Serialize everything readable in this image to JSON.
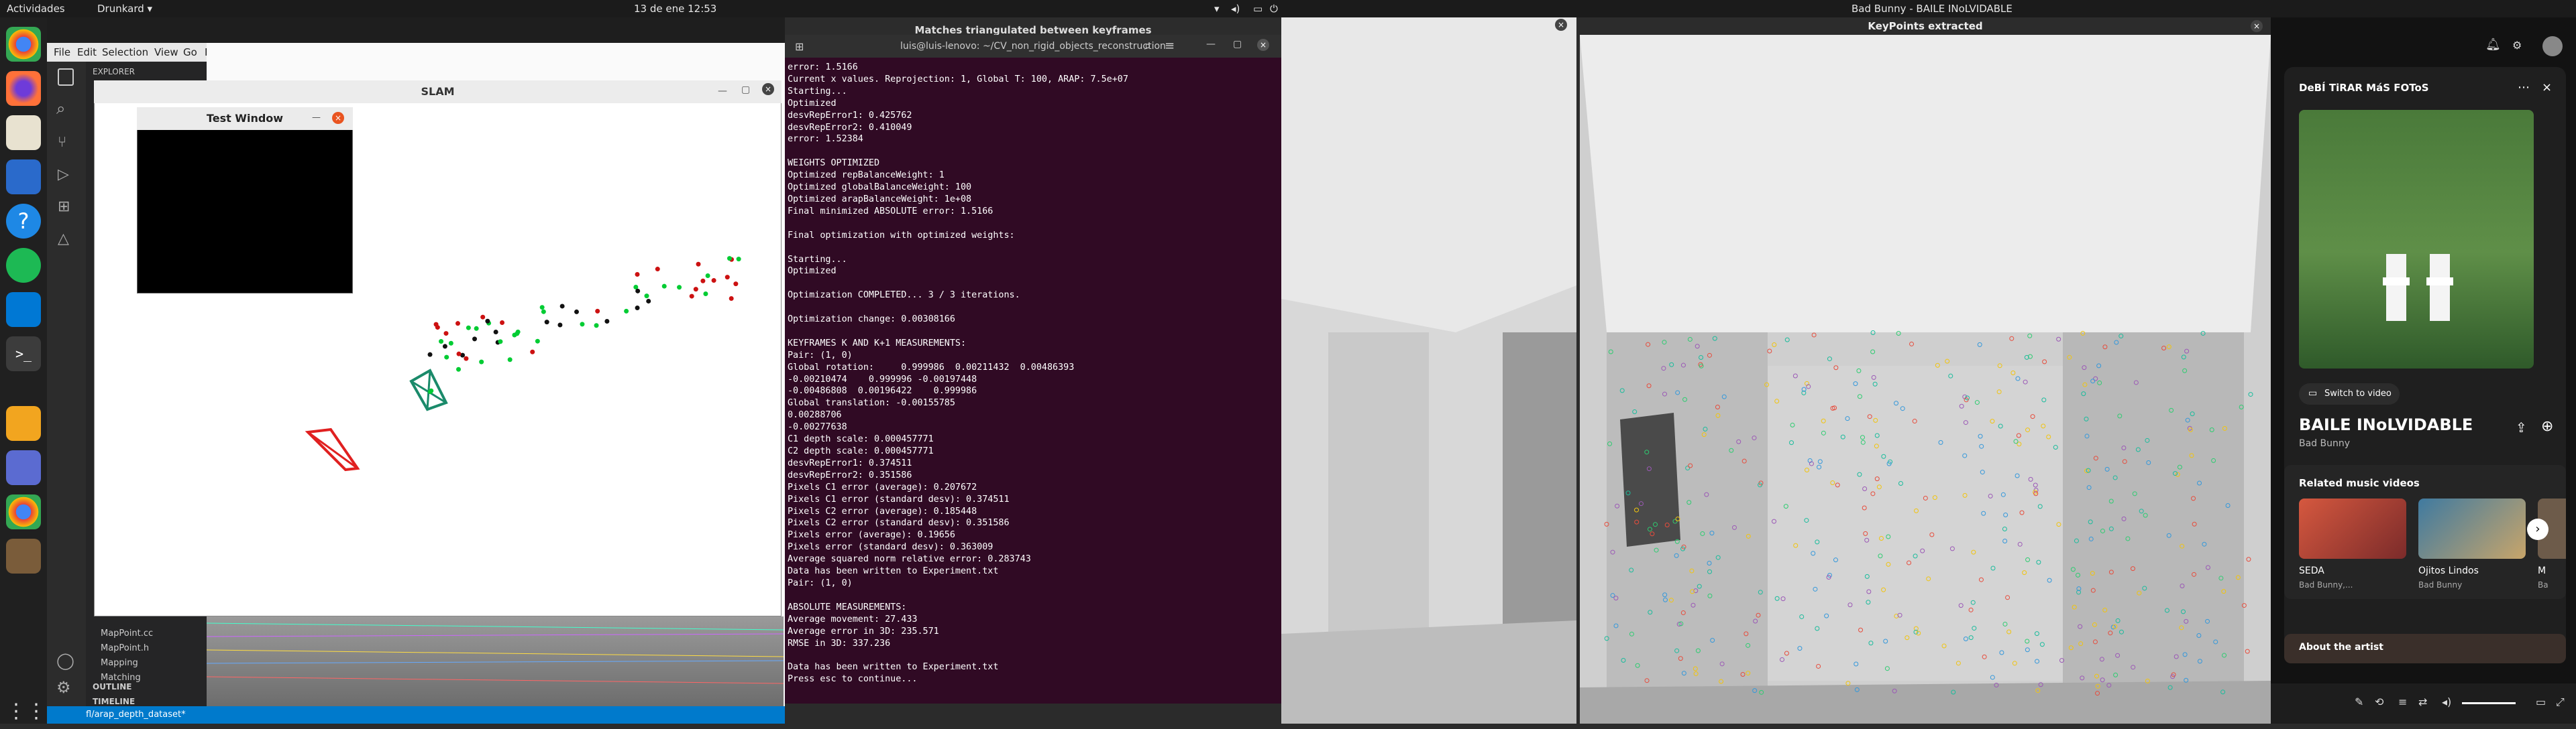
{
  "topbar": {
    "activities": "Actividades",
    "app_menu": "Drunkard ▾",
    "datetime": "13 de ene 12:53",
    "right_window_title": "Bad Bunny - BAILE INoLVIDABLE"
  },
  "vscode": {
    "menu": [
      "File",
      "Edit",
      "Selection",
      "View",
      "Go",
      "R"
    ],
    "explorer_title": "EXPLORER",
    "tree": [
      "MapPoint.cc",
      "MapPoint.h",
      "Mapping",
      "Matching"
    ],
    "outline": "OUTLINE",
    "timeline": "TIMELINE",
    "branch": "fl/arap_depth_dataset*"
  },
  "slam": {
    "title": "SLAM",
    "test_window_title": "Test Window"
  },
  "terminal": {
    "window_title": "Matches triangulated between keyframes",
    "subtitle": "luis@luis-lenovo: ~/CV_non_rigid_objects_reconstruction",
    "lines": [
      "error: 1.5166",
      "Current x values. Reprojection: 1, Global T: 100, ARAP: 7.5e+07",
      "Starting...",
      "Optimized",
      "desvRepError1: 0.425762",
      "desvRepError2: 0.410049",
      "error: 1.52384",
      "",
      "WEIGHTS OPTIMIZED",
      "Optimized repBalanceWeight: 1",
      "Optimized globalBalanceWeight: 100",
      "Optimized arapBalanceWeight: 1e+08",
      "Final minimized ABSOLUTE error: 1.5166",
      "",
      "Final optimization with optimized weights:",
      "",
      "Starting...",
      "Optimized",
      "",
      "Optimization COMPLETED... 3 / 3 iterations.",
      "",
      "Optimization change: 0.00308166",
      "",
      "KEYFRAMES K AND K+1 MEASUREMENTS:",
      "Pair: (1, 0)",
      "Global rotation:     0.999986  0.00211432  0.00486393",
      "-0.00210474    0.999996 -0.00197448",
      "-0.00486808  0.00196422    0.999986",
      "Global translation: -0.00155785",
      "0.00288706",
      "-0.00277638",
      "C1 depth scale: 0.000457771",
      "C2 depth scale: 0.000457771",
      "desvRepError1: 0.374511",
      "desvRepError2: 0.351586",
      "Pixels C1 error (average): 0.207672",
      "Pixels C1 error (standard desv): 0.374511",
      "Pixels C2 error (average): 0.185448",
      "Pixels C2 error (standard desv): 0.351586",
      "Pixels error (average): 0.19656",
      "Pixels error (standard desv): 0.363009",
      "Average squared norm relative error: 0.283743",
      "Data has been written to Experiment.txt",
      "Pair: (1, 0)",
      "",
      "ABSOLUTE MEASUREMENTS:",
      "Average movement: 27.433",
      "Average error in 3D: 235.571",
      "RMSE in 3D: 337.236",
      "",
      "Data has been written to Experiment.txt",
      "Press esc to continue..."
    ]
  },
  "keypoints": {
    "title": "KeyPoints extracted"
  },
  "music": {
    "video_title": "DeBÍ TiRAR MáS FOToS",
    "switch_label": "Switch to video",
    "song_title": "BAILE INoLVIDABLE",
    "artist": "Bad Bunny",
    "related_header": "Related music videos",
    "related": [
      {
        "title": "SEDA",
        "artist": "Bad Bunny,..."
      },
      {
        "title": "Ojitos Lindos",
        "artist": "Bad Bunny"
      },
      {
        "title": "M",
        "artist": "Ba"
      }
    ],
    "about_artist": "About the artist"
  },
  "colors": {
    "terminal_bg": "#300a24",
    "vscode_status": "#007acc",
    "camera_green": "#1a8a6a",
    "camera_red": "#e02020"
  }
}
